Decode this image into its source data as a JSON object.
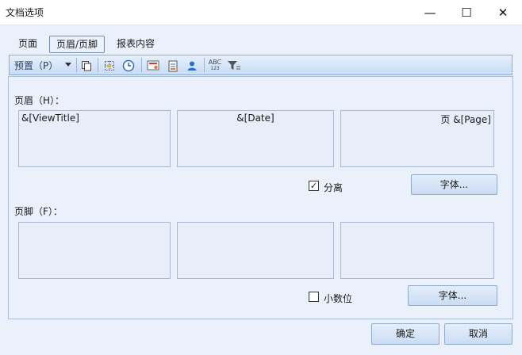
{
  "window": {
    "title": "文档选项",
    "minimize": "—",
    "maximize": "☐",
    "close": "✕"
  },
  "tabs": [
    {
      "label": "页面"
    },
    {
      "label": "页眉/页脚",
      "active": true
    },
    {
      "label": "报表内容"
    }
  ],
  "toolbar": {
    "preset_label": "预置（P）",
    "icons": [
      "copy-icon",
      "grid-icon",
      "clock-icon",
      "image-icon",
      "document-icon",
      "user-icon",
      "abc-icon",
      "filter-icon"
    ]
  },
  "header": {
    "label": "页眉（H）：",
    "left": "&[ViewTitle]",
    "center": "&[Date]",
    "right": "页 &[Page]",
    "separate_checked": true,
    "separate_label": "分离",
    "font_button": "字体..."
  },
  "footer": {
    "label": "页脚（F）：",
    "left": "",
    "center": "",
    "right": "",
    "decimal_checked": false,
    "decimal_label": "小数位",
    "font_button": "字体..."
  },
  "buttons": {
    "ok": "确定",
    "cancel": "取消"
  },
  "colors": {
    "accent": "#8eabd1",
    "background": "#eaf1fb"
  }
}
